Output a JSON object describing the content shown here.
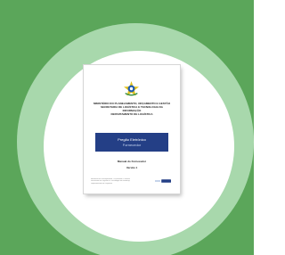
{
  "document": {
    "header_lines": [
      "MINISTÉRIO DO PLANEJAMENTO, ORÇAMENTO E GESTÃO",
      "SECRETARIA DE LOGÍSTICA E TECNOLOGIA DA",
      "INFORMAÇÃO",
      "DEPARTAMENTO DE LOGÍSTICA"
    ],
    "banner": {
      "title": "Pregão Eletrônico",
      "subtitle": "Fornecedor"
    },
    "manual_title": "Manual do Fornecedor",
    "version": "Versão 1",
    "footer_lines": [
      "Ministério do Planejamento, Orçamento e Gestão",
      "Secretaria de Logística e Tecnologia da Informação",
      "Departamento de Logística"
    ]
  },
  "colors": {
    "background": "#5ba65a",
    "ring": "#a8d8ac",
    "banner": "#243f86"
  },
  "icons": {
    "emblem": "brazil-coat-of-arms-icon",
    "logo": "comprasnet-logo"
  }
}
